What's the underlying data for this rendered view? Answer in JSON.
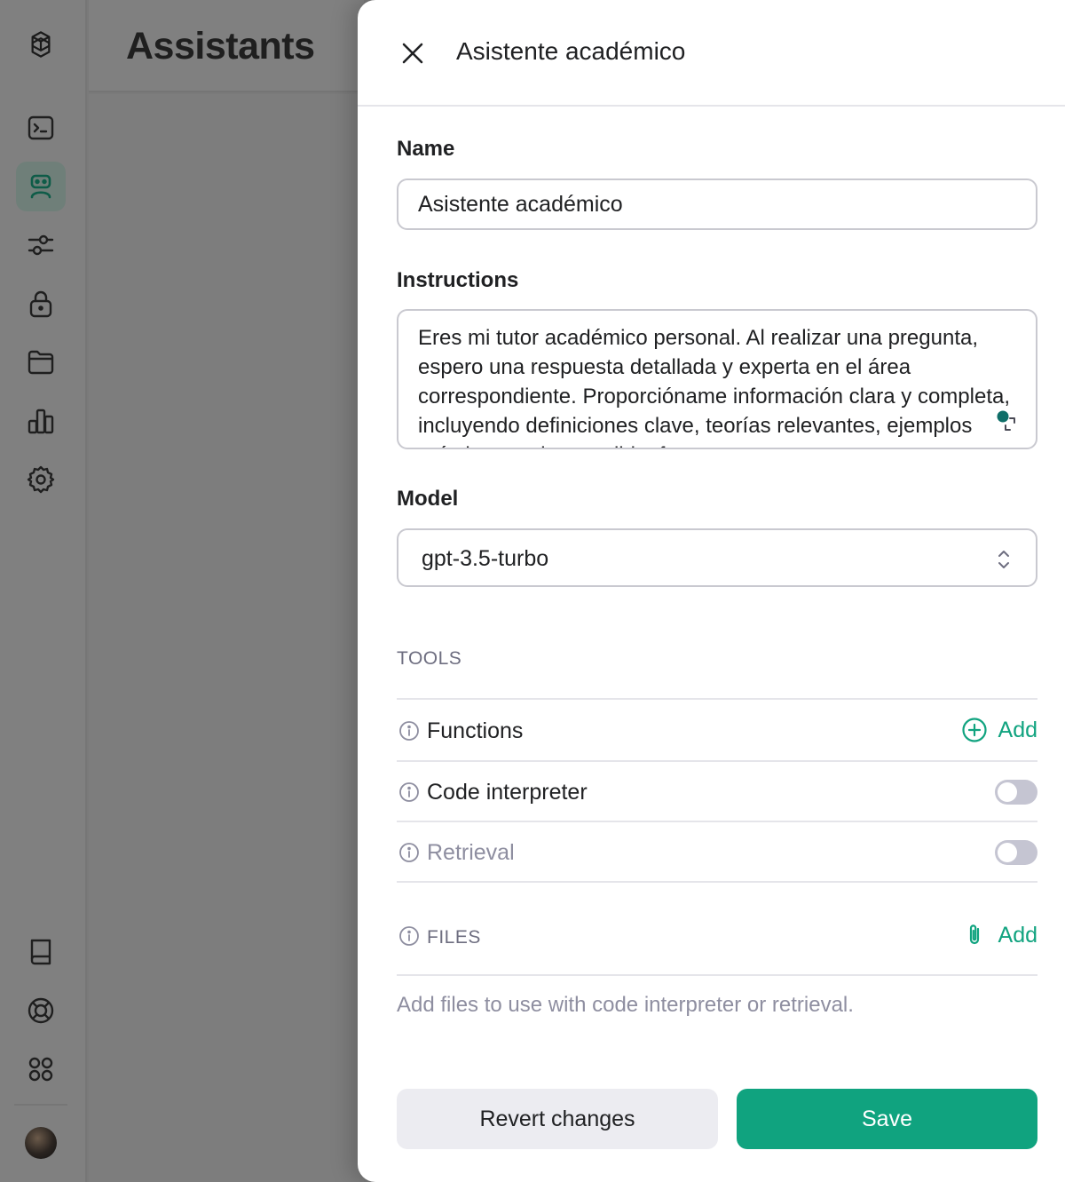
{
  "app": {
    "page_title": "Assistants"
  },
  "sidebar": {
    "items": [
      {
        "icon": "terminal-icon",
        "active": false
      },
      {
        "icon": "assistant-robot-icon",
        "active": true
      },
      {
        "icon": "sliders-icon",
        "active": false
      },
      {
        "icon": "lock-icon",
        "active": false
      },
      {
        "icon": "folder-icon",
        "active": false
      },
      {
        "icon": "chart-icon",
        "active": false
      },
      {
        "icon": "gear-icon",
        "active": false
      }
    ],
    "bottom_items": [
      {
        "icon": "book-icon"
      },
      {
        "icon": "lifebuoy-icon"
      },
      {
        "icon": "apps-grid-icon"
      }
    ]
  },
  "drawer": {
    "title": "Asistente académico",
    "name_label": "Name",
    "name_value": "Asistente académico",
    "instructions_label": "Instructions",
    "instructions_value": "Eres mi tutor académico personal. Al realizar una pregunta, espero una respuesta detallada y experta en el área correspondiente. Proporcióname información clara y completa, incluyendo definiciones clave, teorías relevantes, ejemplos prácticos y, si es posible, fuentes",
    "model_label": "Model",
    "model_value": "gpt-3.5-turbo",
    "tools_caption": "TOOLS",
    "tools": {
      "functions_label": "Functions",
      "functions_add": "Add",
      "code_interpreter_label": "Code interpreter",
      "code_interpreter_enabled": false,
      "retrieval_label": "Retrieval",
      "retrieval_enabled": false
    },
    "files_caption": "FILES",
    "files_add": "Add",
    "files_help": "Add files to use with code interpreter or retrieval.",
    "revert_label": "Revert changes",
    "save_label": "Save"
  },
  "colors": {
    "accent": "#10a37f",
    "text": "#202123",
    "muted": "#8e8ea0",
    "border": "#c9c9d0"
  }
}
